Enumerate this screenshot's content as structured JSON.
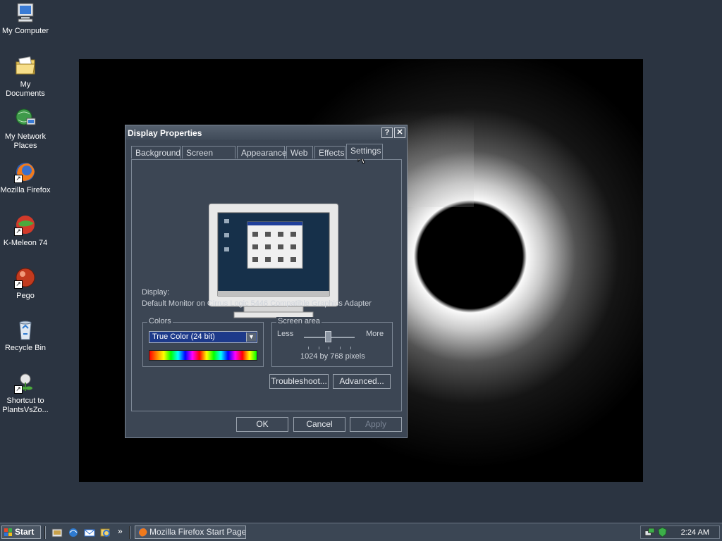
{
  "desktop": {
    "icons": [
      {
        "name": "my-computer",
        "label": "My Computer",
        "icon": "computer-icon"
      },
      {
        "name": "my-documents",
        "label": "My Documents",
        "icon": "folder-icon"
      },
      {
        "name": "my-network-places",
        "label": "My Network Places",
        "icon": "network-icon"
      },
      {
        "name": "mozilla-firefox",
        "label": "Mozilla Firefox",
        "icon": "firefox-icon"
      },
      {
        "name": "k-meleon",
        "label": "K-Meleon 74",
        "icon": "k-meleon-icon"
      },
      {
        "name": "pego",
        "label": "Pego",
        "icon": "pego-icon"
      },
      {
        "name": "recycle-bin",
        "label": "Recycle Bin",
        "icon": "recycle-bin-icon"
      },
      {
        "name": "plantsvszombies",
        "label": "Shortcut to PlantsVsZo...",
        "icon": "plant-icon"
      }
    ]
  },
  "dialog": {
    "title": "Display Properties",
    "help_button": "?",
    "close_button": "✕",
    "tabs": [
      "Background",
      "Screen Saver",
      "Appearance",
      "Web",
      "Effects",
      "Settings"
    ],
    "active_tab": "Settings",
    "display_label": "Display:",
    "display_value": "Default Monitor on Cirrus Logic 5446 Compatible Graphics Adapter",
    "colors": {
      "legend": "Colors",
      "selected": "True Color (24 bit)"
    },
    "screen_area": {
      "legend": "Screen area",
      "less_label": "Less",
      "more_label": "More",
      "resolution": "1024 by 768 pixels",
      "slider_fraction": 0.45
    },
    "buttons": {
      "troubleshoot": "Troubleshoot...",
      "advanced": "Advanced...",
      "ok": "OK",
      "cancel": "Cancel",
      "apply": "Apply"
    }
  },
  "taskbar": {
    "start_label": "Start",
    "overflow_chevron": "»",
    "task_label": "Mozilla Firefox Start Page...",
    "clock": "2:24 AM"
  }
}
